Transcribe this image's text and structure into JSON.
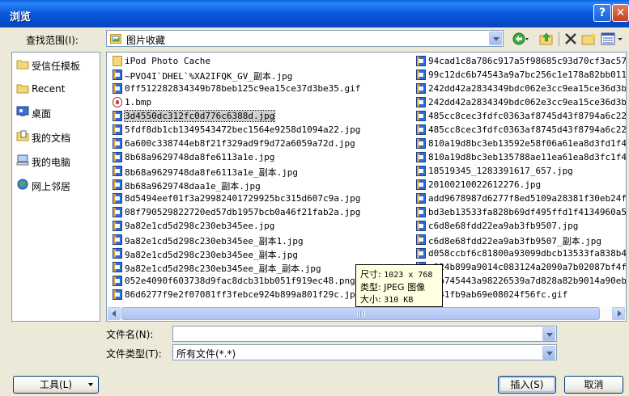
{
  "window": {
    "title": "浏览",
    "help_glyph": "?",
    "close_glyph": "✕"
  },
  "lookin": {
    "label": "查找范围(I):",
    "value": "图片收藏"
  },
  "toolbar": {
    "icons": [
      "back-icon",
      "up-folder-icon",
      "delete-icon",
      "new-folder-icon",
      "views-menu-icon"
    ]
  },
  "places": [
    {
      "label": "受信任模板",
      "icon": "folder-icon"
    },
    {
      "label": "Recent",
      "icon": "folder-icon"
    },
    {
      "label": "桌面",
      "icon": "desktop-icon"
    },
    {
      "label": "我的文档",
      "icon": "my-documents-icon"
    },
    {
      "label": "我的电脑",
      "icon": "my-computer-icon"
    },
    {
      "label": "网上邻居",
      "icon": "network-icon"
    }
  ],
  "files_col1": [
    {
      "name": "iPod Photo Cache",
      "type": "folder"
    },
    {
      "name": "~PVO4I`DHEL`%XA2IFQK_GV_副本.jpg",
      "type": "img"
    },
    {
      "name": "0ff512282834349b78beb125c9ea15ce37d3be35.gif",
      "type": "img"
    },
    {
      "name": "1.bmp",
      "type": "bmp"
    },
    {
      "name": "3d4550dc312fc0d776c6388d.jpg",
      "type": "img",
      "selected": true
    },
    {
      "name": "5fdf8db1cb1349543472bec1564e9258d1094a22.jpg",
      "type": "img"
    },
    {
      "name": "6a600c338744eb8f21f329ad9f9d72a6059a72d.jpg",
      "type": "img"
    },
    {
      "name": "8b68a9629748da8fe6113a1e.jpg",
      "type": "img"
    },
    {
      "name": "8b68a9629748da8fe6113a1e_副本.jpg",
      "type": "img"
    },
    {
      "name": "8b68a9629748daa1e_副本.jpg",
      "type": "img"
    },
    {
      "name": "8d5494eef01f3a29982401729925bc315d607c9a.jpg",
      "type": "img"
    },
    {
      "name": "08f790529822720ed57db1957bcb0a46f21fab2a.jpg",
      "type": "img"
    },
    {
      "name": "9a82e1cd5d298c230eb345ee.jpg",
      "type": "img"
    },
    {
      "name": "9a82e1cd5d298c230eb345ee_副本1.jpg",
      "type": "img"
    },
    {
      "name": "9a82e1cd5d298c230eb345ee_副本.jpg",
      "type": "img"
    },
    {
      "name": "9a82e1cd5d298c230eb345ee_副本_副本.jpg",
      "type": "img"
    },
    {
      "name": "052e4090f603738d9fac8dcb31bb051f919ec48.png",
      "type": "img"
    },
    {
      "name": "86d6277f9e2f07081ff3febce924b899a801f29c.jpg",
      "type": "img"
    }
  ],
  "files_col2": [
    {
      "name": "94cad1c8a786c917a5f98685c93d70cf3ac57590.",
      "type": "img"
    },
    {
      "name": "99c12dc6b74543a9a7bc256c1e178a82bb0114c1.",
      "type": "img"
    },
    {
      "name": "242dd42a2834349bdc062e3cc9ea15ce36d3be03.",
      "type": "img"
    },
    {
      "name": "242dd42a2834349bdc062e3cc9ea15ce36d3be03_",
      "type": "img"
    },
    {
      "name": "485cc8cec3fdfc0363af8745d43f8794a6c2269c.",
      "type": "img"
    },
    {
      "name": "485cc8cec3fdfc0363af8745d43f8794a6c2269c_",
      "type": "img"
    },
    {
      "name": "810a19d8bc3eb13592e58f06a61ea8d3fd1f4468.",
      "type": "img"
    },
    {
      "name": "810a19d8bc3eb135788ae11ea61ea8d3fc1f44c1.",
      "type": "img"
    },
    {
      "name": "18519345_1283391617_657.jpg",
      "type": "img"
    },
    {
      "name": "20100210022612276.jpg",
      "type": "img"
    },
    {
      "name": "add9678987d6277f8ed5109a28381f30eb24fca3.",
      "type": "img"
    },
    {
      "name": "bd3eb13533fa828b69df495ffd1f4134960a5a8a.",
      "type": "img"
    },
    {
      "name": "c6d8e68fdd22ea9ab3fb9507.jpg",
      "type": "img"
    },
    {
      "name": "c6d8e68fdd22ea9ab3fb9507_副本.jpg",
      "type": "img"
    },
    {
      "name": "d058ccbf6c81800a93099dbcb13533fa838b4797.",
      "type": "img"
    },
    {
      "name": "e924b899a9014c083124a2090a7b02087bf4f47b.",
      "type": "img"
    },
    {
      "name": "f1b745443a98226539a7d828a82b9014a90eb38.",
      "type": "img"
    },
    {
      "name": "fe41fb9ab69e08024f56fc.gif",
      "type": "img"
    }
  ],
  "tooltip": {
    "size_label": "尺寸:",
    "size_value": "1023 x 768",
    "type_label": "类型:",
    "type_value": "JPEG 图像",
    "filesize_label": "大小:",
    "filesize_value": "310 KB"
  },
  "filename": {
    "label": "文件名(N):",
    "value": ""
  },
  "filetype": {
    "label": "文件类型(T):",
    "value": "所有文件(*.*)"
  },
  "buttons": {
    "tools": "工具(L)",
    "insert": "插入(S)",
    "cancel": "取消"
  }
}
